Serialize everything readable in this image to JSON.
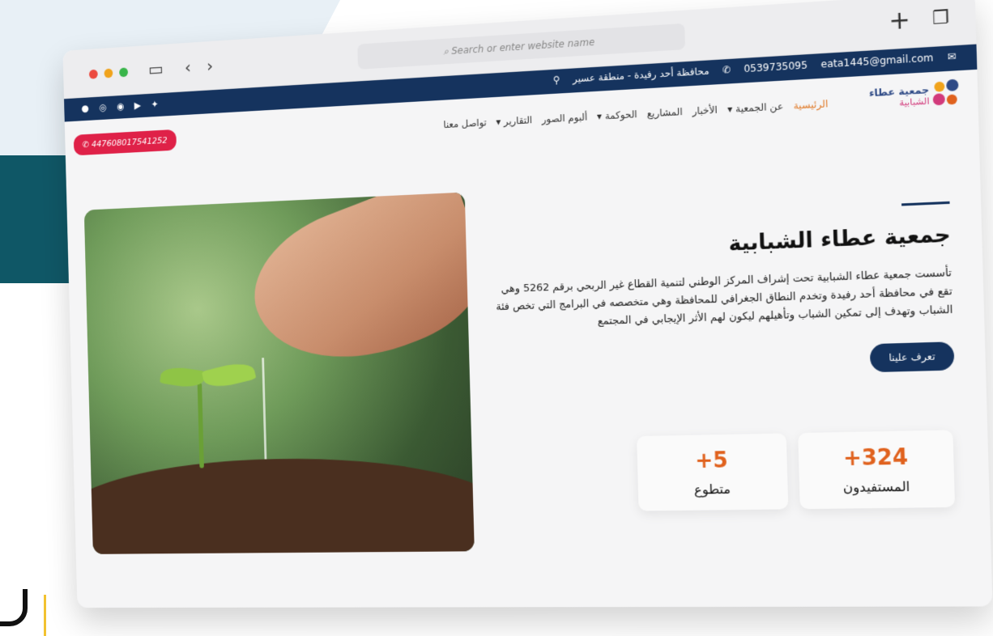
{
  "browser": {
    "address_placeholder": "Search or enter website name",
    "new_tab_icon": "plus-icon",
    "tabs_icon": "tabs-icon"
  },
  "topbar": {
    "email": "eata1445@gmail.com",
    "phone": "0539735095",
    "location": "محافظة أحد رفيدة - منطقة عسير",
    "socials": [
      "snapchat-icon",
      "instagram-icon",
      "whatsapp-icon",
      "youtube-icon",
      "twitter-icon"
    ]
  },
  "logo": {
    "name": "جمعية عطاء",
    "sub": "الشبابية"
  },
  "nav": {
    "items": [
      {
        "label": "الرئيسية",
        "active": true
      },
      {
        "label": "عن الجمعية ▾"
      },
      {
        "label": "الأخبار"
      },
      {
        "label": "المشاريع"
      },
      {
        "label": "الحوكمة ▾"
      },
      {
        "label": "ألبوم الصور"
      },
      {
        "label": "التقارير ▾"
      },
      {
        "label": "تواصل معنا"
      }
    ],
    "phone_button": "447608017541252"
  },
  "hero": {
    "title": "جمعية عطاء الشبابية",
    "description": "تأسست جمعية عطاء الشبابية تحت إشراف المركز الوطني لتنمية القطاع غير الربحي برقم 5262 وهي تقع في محافظة أحد رفيدة وتخدم النطاق الجغرافي للمحافظة وهي متخصصه في البرامج التي تخص فئة الشباب وتهدف إلى تمكين الشباب وتأهيلهم ليكون لهم الأثر الإيجابي في المجتمع",
    "cta": "تعرف علينا"
  },
  "stats": [
    {
      "value": "+324",
      "label": "المستفيدون"
    },
    {
      "value": "+5",
      "label": "متطوع"
    }
  ],
  "colors": {
    "navy": "#15335e",
    "accent_orange": "#e0621e",
    "phone_red": "#df2148"
  }
}
